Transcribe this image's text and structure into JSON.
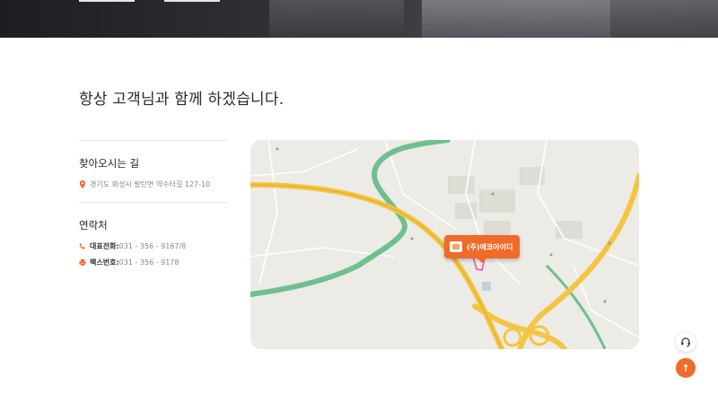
{
  "headline": "항상 고객님과 함께 하겠습니다.",
  "directions": {
    "title": "찾아오시는 길",
    "address": "경기도 화성시 팔탄면 약수터길 127-10"
  },
  "contact": {
    "title": "연락처",
    "phone_label": "대표전화:",
    "phone_value": " 031 - 356 - 9167/8",
    "fax_label": "팩스번호:",
    "fax_value": " 031 - 356 - 9178"
  },
  "map": {
    "marker_label": "(주)에코아이디"
  },
  "actions": {
    "top_arrow": "↑"
  },
  "colors": {
    "accent": "#f06a28",
    "road": "#f4c542",
    "river": "#6fbf8f"
  },
  "icons": [
    "location-pin-icon",
    "phone-icon",
    "fax-icon",
    "headset-icon",
    "arrow-up-icon"
  ]
}
